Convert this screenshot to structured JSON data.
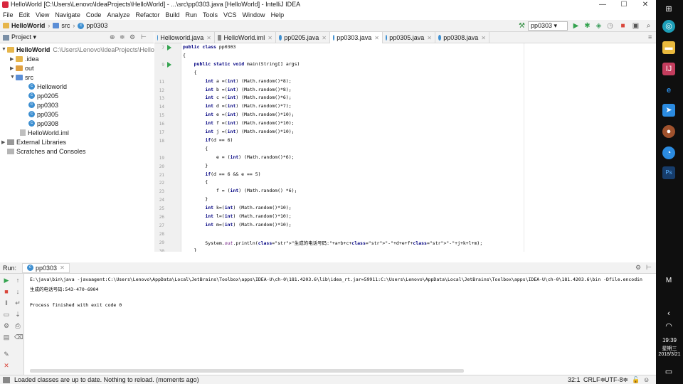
{
  "window": {
    "title": "HelloWorld [C:\\Users\\Lenovo\\IdeaProjects\\HelloWorld] - ...\\src\\pp0303.java [HelloWorld] - IntelliJ IDEA",
    "controls": [
      "—",
      "☐",
      "✕"
    ]
  },
  "menu": [
    "File",
    "Edit",
    "View",
    "Navigate",
    "Code",
    "Analyze",
    "Refactor",
    "Build",
    "Run",
    "Tools",
    "VCS",
    "Window",
    "Help"
  ],
  "navbar": {
    "crumbs": [
      "HelloWorld",
      "src",
      "pp0303"
    ],
    "run_config": "pp0303 ▾"
  },
  "project_panel": {
    "title": "Project ▾",
    "tree": [
      {
        "label": "HelloWorld",
        "suffix": "C:\\Users\\Lenovo\\IdeaProjects\\HelloWorld",
        "kind": "module",
        "arrow": "▼"
      },
      {
        "label": ".idea",
        "kind": "folder",
        "arrow": "▶"
      },
      {
        "label": "out",
        "kind": "folder",
        "arrow": "▶"
      },
      {
        "label": "src",
        "kind": "folder-blue",
        "arrow": "▼"
      },
      {
        "label": "Helloworld",
        "kind": "class"
      },
      {
        "label": "pp0205",
        "kind": "class"
      },
      {
        "label": "pp0303",
        "kind": "class"
      },
      {
        "label": "pp0305",
        "kind": "class"
      },
      {
        "label": "pp0308",
        "kind": "class"
      },
      {
        "label": "HelloWorld.iml",
        "kind": "file"
      },
      {
        "label": "External Libraries",
        "kind": "lib",
        "arrow": "▶"
      },
      {
        "label": "Scratches and Consoles",
        "kind": "lib"
      }
    ]
  },
  "tabs": [
    {
      "label": "Helloworld.java",
      "active": false
    },
    {
      "label": "HelloWorld.iml",
      "active": false
    },
    {
      "label": "pp0205.java",
      "active": false
    },
    {
      "label": "pp0303.java",
      "active": true
    },
    {
      "label": "pp0305.java",
      "active": false
    },
    {
      "label": "pp0308.java",
      "active": false
    }
  ],
  "editor": {
    "lines": [
      {
        "n": "7",
        "run": true,
        "text": "public class pp0303"
      },
      {
        "n": "",
        "run": false,
        "text": "{"
      },
      {
        "n": "9",
        "run": true,
        "text": "    public static void main(String[] args)"
      },
      {
        "n": "",
        "run": false,
        "text": "    {"
      },
      {
        "n": "11",
        "run": false,
        "text": "        int a =(int) (Math.random()*8);"
      },
      {
        "n": "12",
        "run": false,
        "text": "        int b =(int) (Math.random()*8);"
      },
      {
        "n": "13",
        "run": false,
        "text": "        int c =(int) (Math.random()*6);"
      },
      {
        "n": "14",
        "run": false,
        "text": "        int d =(int) (Math.random()*7);"
      },
      {
        "n": "15",
        "run": false,
        "text": "        int e =(int) (Math.random()*10);"
      },
      {
        "n": "16",
        "run": false,
        "text": "        int f =(int) (Math.random()*10);"
      },
      {
        "n": "17",
        "run": false,
        "text": "        int j =(int) (Math.random()*10);"
      },
      {
        "n": "18",
        "run": false,
        "text": "        if(d == 6)"
      },
      {
        "n": "",
        "run": false,
        "text": "        {"
      },
      {
        "n": "19",
        "run": false,
        "text": "            e = (int) (Math.random()*6);"
      },
      {
        "n": "20",
        "run": false,
        "text": "        }"
      },
      {
        "n": "21",
        "run": false,
        "text": "        if(d == 6 && e == 5)"
      },
      {
        "n": "22",
        "run": false,
        "text": "        {"
      },
      {
        "n": "23",
        "run": false,
        "text": "            f = (int) (Math.random() *6);"
      },
      {
        "n": "24",
        "run": false,
        "text": "        }"
      },
      {
        "n": "25",
        "run": false,
        "text": "        int k=(int) (Math.random()*10);"
      },
      {
        "n": "26",
        "run": false,
        "text": "        int l=(int) (Math.random()*10);"
      },
      {
        "n": "27",
        "run": false,
        "text": "        int m=(int) (Math.random()*10);"
      },
      {
        "n": "28",
        "run": false,
        "text": ""
      },
      {
        "n": "29",
        "run": false,
        "text": "        System.out.println(\"生成的电话号码:\"+a+b+c+\"-\"+d+e+f+\"-\"+j+k+l+m);"
      },
      {
        "n": "30",
        "run": false,
        "text": "    }"
      }
    ]
  },
  "run_panel": {
    "label": "Run:",
    "tab": "pp0303",
    "console": [
      "E:\\java\\bin\\java -javaagent:C:\\Users\\Lenovo\\AppData\\Local\\JetBrains\\Toolbox\\apps\\IDEA-U\\ch-0\\181.4203.6\\lib\\idea_rt.jar=59911:C:\\Users\\Lenovo\\AppData\\Local\\JetBrains\\Toolbox\\apps\\IDEA-U\\ch-0\\181.4203.6\\bin -Dfile.encodin",
      "生成的电话号码:543-470-6904",
      "",
      "Process finished with exit code 0"
    ]
  },
  "status": {
    "message": "Loaded classes are up to date. Nothing to reload. (moments ago)",
    "position": "32:1",
    "line_sep": "CRLF≑",
    "encoding": "UTF-8≑"
  },
  "taskbar": {
    "time": "19:39",
    "weekday": "星期三",
    "date": "2018/3/21",
    "ime": "M"
  },
  "colors": {
    "keyword": "#000080",
    "string": "#008000",
    "run_green": "#34a34f",
    "taskbar": "#0f0f0f"
  }
}
